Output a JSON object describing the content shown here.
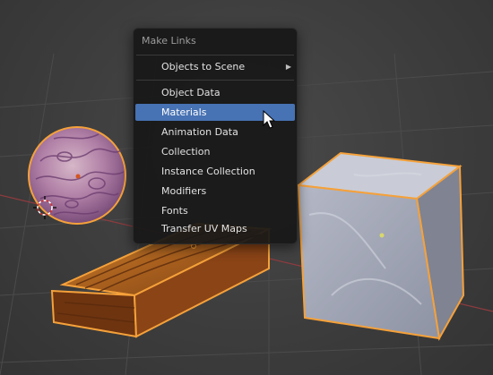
{
  "menu": {
    "title": "Make Links",
    "items": [
      {
        "label": "Objects to Scene",
        "submenu": true
      },
      {
        "label": "Object Data"
      },
      {
        "label": "Materials",
        "highlighted": true
      },
      {
        "label": "Animation Data"
      },
      {
        "label": "Collection"
      },
      {
        "label": "Instance Collection"
      },
      {
        "label": "Modifiers"
      },
      {
        "label": "Fonts"
      },
      {
        "label": "Transfer UV Maps"
      }
    ]
  },
  "colors": {
    "highlight": "#4772b3",
    "selection_outline": "#f5a13a",
    "menu_background": "#181818"
  },
  "icons": {
    "submenu": "chevron-right-icon",
    "cursor": "mouse-pointer-icon",
    "scene_cursor": "3d-cursor-icon"
  }
}
